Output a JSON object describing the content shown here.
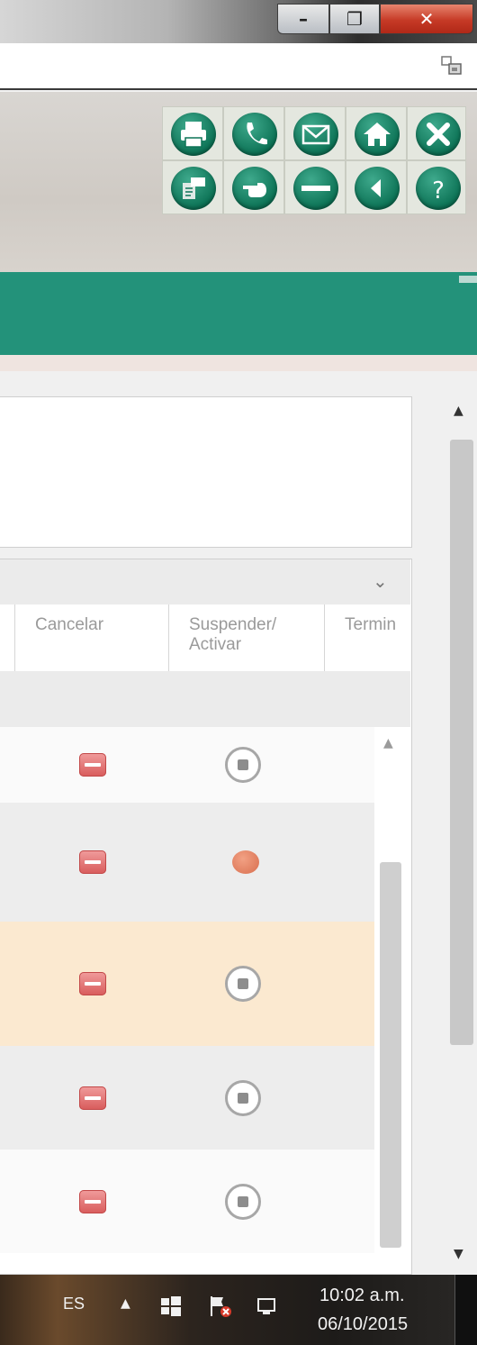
{
  "window": {
    "minimize_icon": "minimize-icon",
    "restore_icon": "restore-icon",
    "close_icon": "close-icon"
  },
  "toolbar_icons": [
    "print-icon",
    "phone-icon",
    "mail-icon",
    "home-icon",
    "close-x-icon",
    "exchange-icon",
    "pointing-hand-icon",
    "minus-icon",
    "back-arrow-icon",
    "help-icon"
  ],
  "colors": {
    "teal_band": "#23927a",
    "icon_green": "#0d7356",
    "highlight_row": "#fbe9d0",
    "cancel_red": "#d85b5b",
    "status_orange": "#d86e4e"
  },
  "grid": {
    "columns": [
      {
        "label": ""
      },
      {
        "label": "Cancelar"
      },
      {
        "label": "Suspender/\nActivar"
      },
      {
        "label": "Termin"
      }
    ],
    "rows": [
      {
        "cancel_icon": "cancel-icon",
        "status": "inactive",
        "highlighted": false,
        "bg": "#fafafa"
      },
      {
        "cancel_icon": "cancel-icon",
        "status": "active",
        "highlighted": false,
        "bg": "#ededed"
      },
      {
        "cancel_icon": "cancel-icon",
        "status": "inactive",
        "highlighted": true,
        "bg": "#fbe9d0"
      },
      {
        "cancel_icon": "cancel-icon",
        "status": "inactive",
        "highlighted": false,
        "bg": "#ededed"
      },
      {
        "cancel_icon": "cancel-icon",
        "status": "inactive",
        "highlighted": false,
        "bg": "#fafafa"
      }
    ]
  },
  "taskbar": {
    "language": "ES",
    "time": "10:02 a.m.",
    "date": "06/10/2015"
  }
}
